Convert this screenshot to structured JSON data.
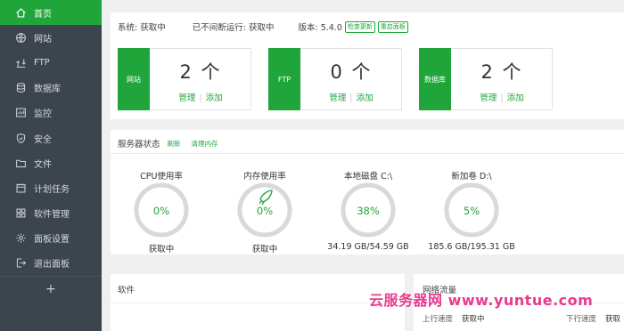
{
  "sidebar": {
    "items": [
      {
        "label": "首页",
        "icon": "home-icon",
        "active": true
      },
      {
        "label": "网站",
        "icon": "globe-icon"
      },
      {
        "label": "FTP",
        "icon": "ftp-icon"
      },
      {
        "label": "数据库",
        "icon": "database-icon"
      },
      {
        "label": "监控",
        "icon": "monitor-icon"
      },
      {
        "label": "安全",
        "icon": "shield-icon"
      },
      {
        "label": "文件",
        "icon": "folder-icon"
      },
      {
        "label": "计划任务",
        "icon": "calendar-icon"
      },
      {
        "label": "软件管理",
        "icon": "apps-icon"
      },
      {
        "label": "面板设置",
        "icon": "gear-icon"
      },
      {
        "label": "退出面板",
        "icon": "logout-icon"
      }
    ],
    "add_label": "+"
  },
  "system": {
    "os_label": "系统: 获取中",
    "uptime_label": "已不间断运行: 获取中",
    "version_label": "版本: 5.4.0",
    "check_update": "检查更新",
    "restart_panel": "重启面板"
  },
  "cards": [
    {
      "tag": "网站",
      "count": "2 个",
      "manage": "管理",
      "add": "添加"
    },
    {
      "tag": "FTP",
      "count": "0 个",
      "manage": "管理",
      "add": "添加"
    },
    {
      "tag": "数据库",
      "count": "2 个",
      "manage": "管理",
      "add": "添加"
    }
  ],
  "status": {
    "title": "服务器状态",
    "refresh": "刷新",
    "clear_memory": "清理内存",
    "gauges": [
      {
        "title": "CPU使用率",
        "percent": "0%",
        "value": 0,
        "sub": "获取中",
        "rocket": false
      },
      {
        "title": "内存使用率",
        "percent": "0%",
        "value": 0,
        "sub": "获取中",
        "rocket": true
      },
      {
        "title": "本地磁盘 C:\\",
        "percent": "38%",
        "value": 38,
        "sub": "34.19 GB/54.59 GB",
        "rocket": false
      },
      {
        "title": "新加卷 D:\\",
        "percent": "5%",
        "value": 5,
        "sub": "185.6 GB/195.31 GB",
        "rocket": false
      }
    ]
  },
  "software": {
    "title": "软件"
  },
  "traffic": {
    "title": "网络流量",
    "up_label": "上行速度",
    "up_value": "获取中",
    "down_label": "下行速度",
    "down_value": "获取"
  },
  "watermark": "云服务器网 www.yuntue.com",
  "colors": {
    "accent": "#20a53a",
    "sidebar_bg": "#3c444d",
    "watermark": "#e8308a"
  }
}
